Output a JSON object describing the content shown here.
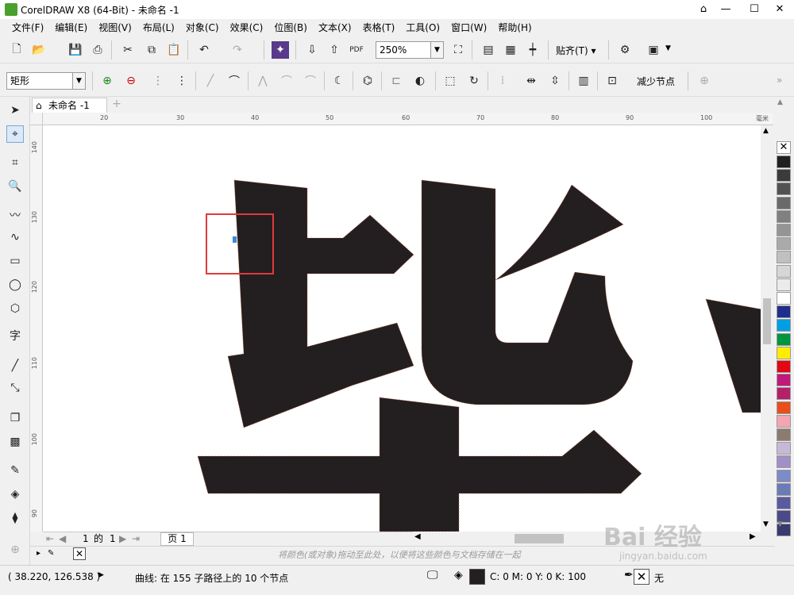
{
  "window": {
    "title": "CorelDRAW X8 (64-Bit) - 未命名 -1"
  },
  "menu": [
    "文件(F)",
    "编辑(E)",
    "视图(V)",
    "布局(L)",
    "对象(C)",
    "效果(C)",
    "位图(B)",
    "文本(X)",
    "表格(T)",
    "工具(O)",
    "窗口(W)",
    "帮助(H)"
  ],
  "toolbar": {
    "zoom": "250%",
    "snap_label": "贴齐(T)"
  },
  "propertybar": {
    "shape_combo": "矩形",
    "reduce_nodes_label": "减少节点"
  },
  "doc_tab": {
    "label": "未命名 -1"
  },
  "ruler": {
    "h_ticks": [
      "20",
      "30",
      "40",
      "50",
      "60",
      "70",
      "80",
      "90",
      "100"
    ],
    "h_unit": "毫米",
    "v_ticks": [
      "140",
      "130",
      "120",
      "110",
      "100",
      "90"
    ]
  },
  "pagebar": {
    "current": "1",
    "of_label": "的",
    "total": "1",
    "page_tab": "页 1"
  },
  "docpalette": {
    "hint": "将颜色(或对象)拖动至此处，以便将这些颜色与文档存储在一起"
  },
  "status": {
    "coords": "( 38.220, 126.538 )",
    "info": "曲线: 在 155 子路径上的 10 个节点",
    "fill": "C: 0 M: 0 Y: 0 K: 100",
    "outline": "无"
  },
  "palette_colors": [
    "#231f20",
    "#3b3b3b",
    "#525252",
    "#6a6a6a",
    "#808080",
    "#959595",
    "#aaaaaa",
    "#c0c0c0",
    "#d6d6d6",
    "#ebebeb",
    "#ffffff",
    "#1f2e8c",
    "#009fe3",
    "#00963f",
    "#ffed00",
    "#e30613",
    "#c2177b",
    "#b51f6b",
    "#e94e1b",
    "#f4a6b0",
    "#8c7b70",
    "#c8b8d8",
    "#a090c8",
    "#7b8cc8",
    "#6a7bb8",
    "#5a5aa0",
    "#4a4a88",
    "#3a3a70"
  ],
  "fill_color": "#231f20",
  "watermark": {
    "brand": "Bai 经验",
    "url": "jingyan.baidu.com"
  }
}
